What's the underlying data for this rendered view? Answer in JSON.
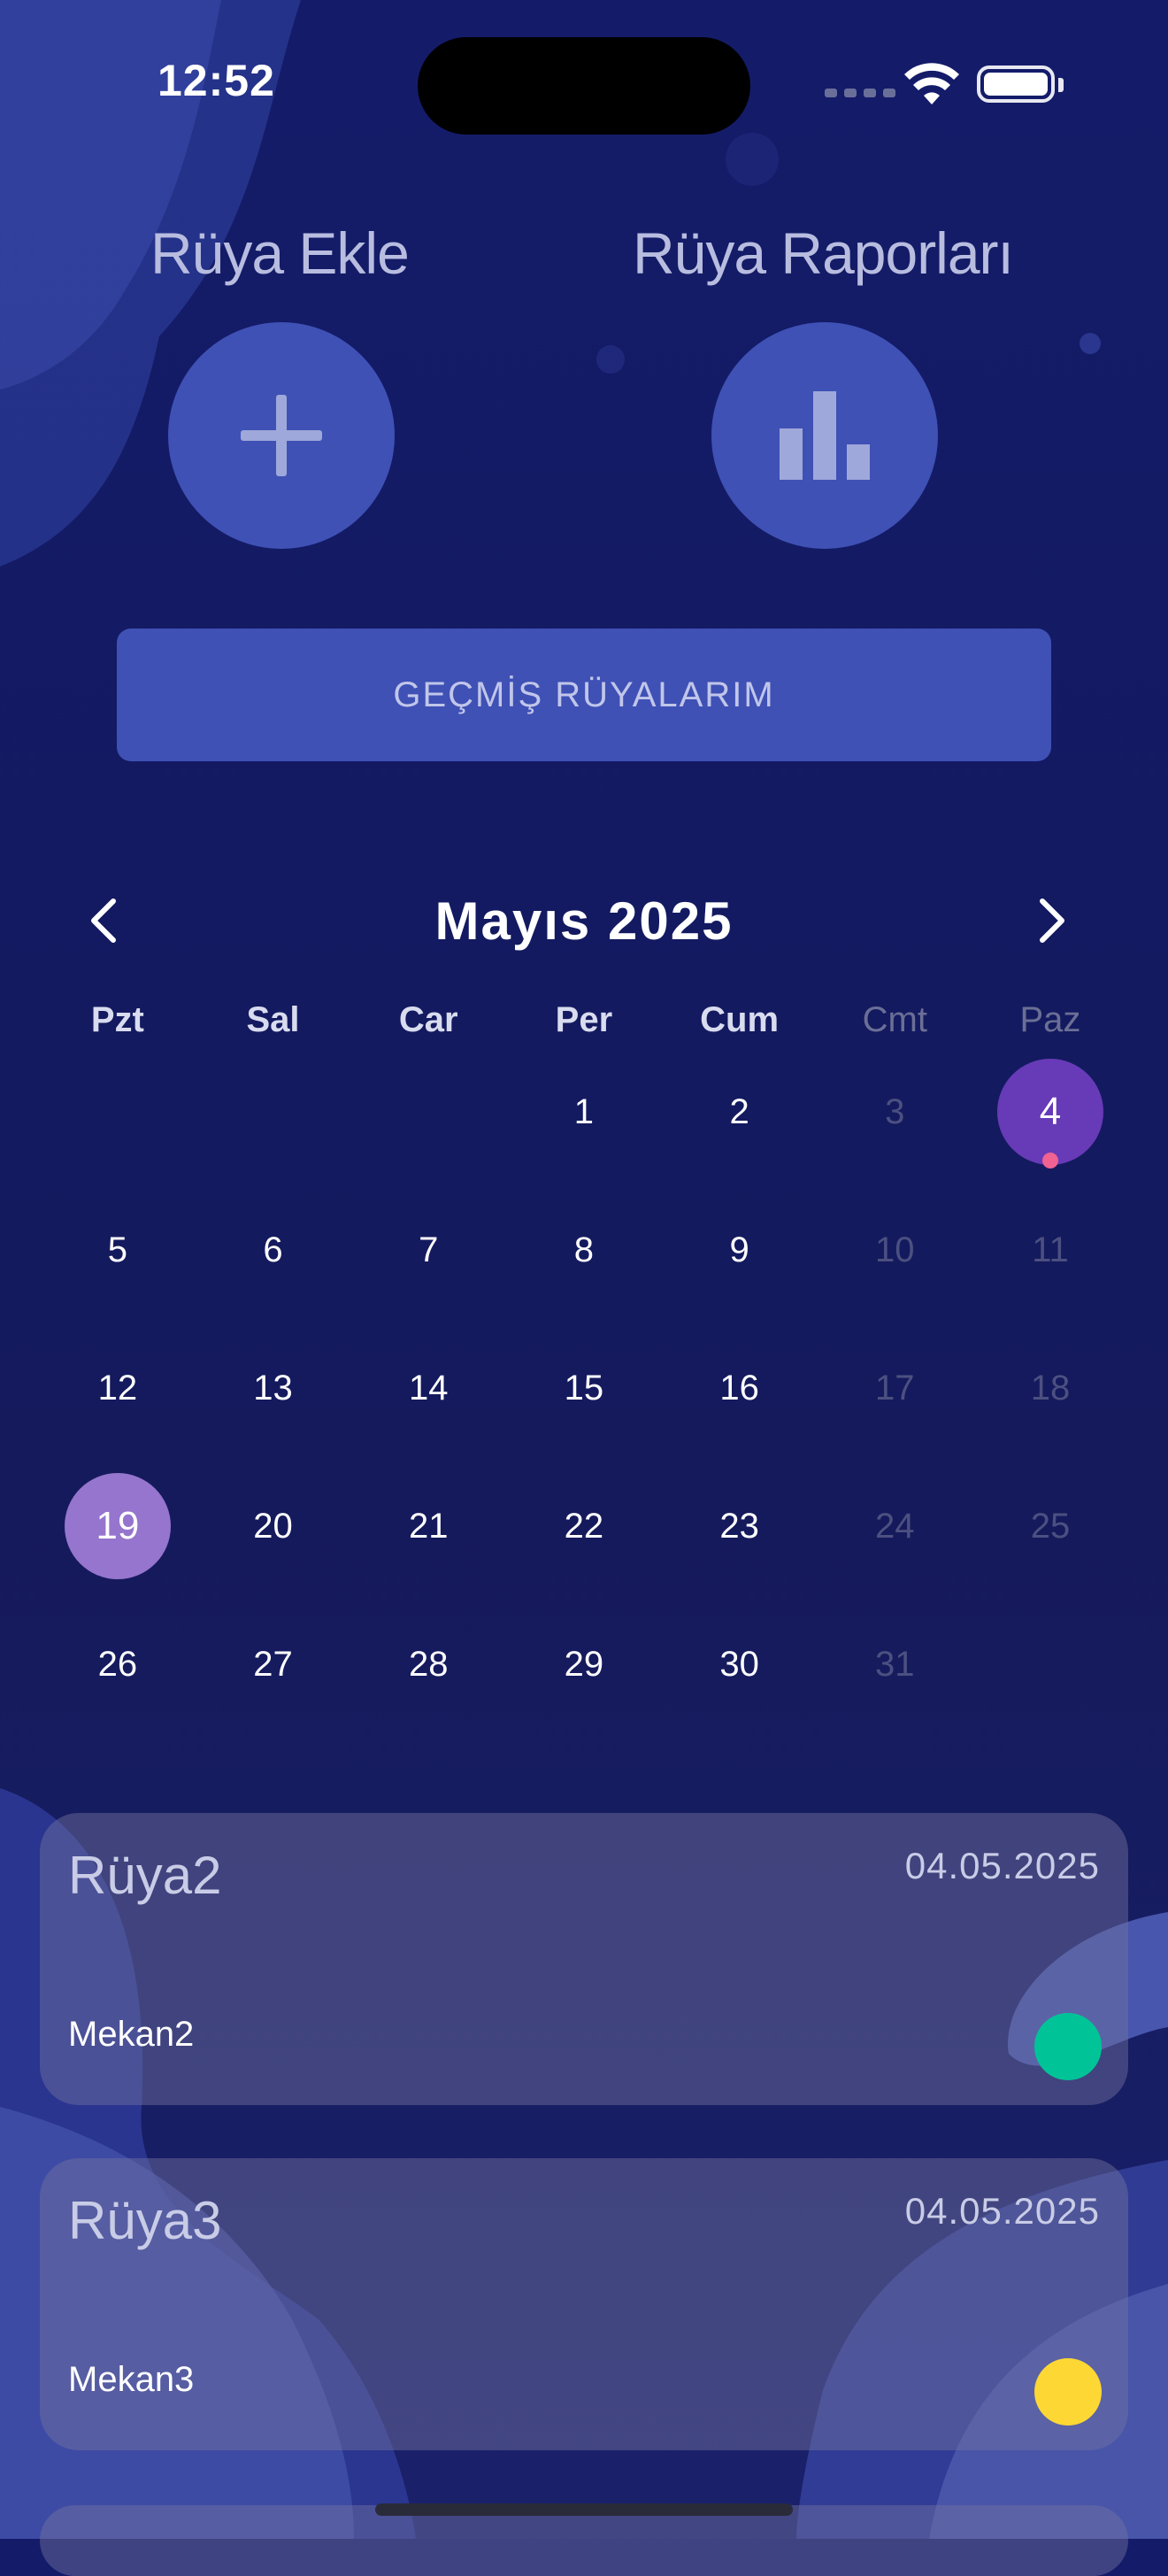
{
  "status_bar": {
    "time": "12:52"
  },
  "actions": {
    "add_label": "Rüya Ekle",
    "reports_label": "Rüya Raporları",
    "add_icon": "plus-icon",
    "reports_icon": "bar-chart-icon"
  },
  "history_button": "GEÇMİŞ RÜYALARIM",
  "calendar": {
    "month_title": "Mayıs 2025",
    "weekdays": [
      "Pzt",
      "Sal",
      "Car",
      "Per",
      "Cum",
      "Cmt",
      "Paz"
    ],
    "leading_blanks": 3,
    "days_in_month": 31,
    "selected_day": 4,
    "today_day": 19,
    "marked_days": [
      4
    ]
  },
  "dreams": [
    {
      "title": "Rüya2",
      "date": "04.05.2025",
      "place": "Mekan2",
      "mood_color": "#00c497"
    },
    {
      "title": "Rüya3",
      "date": "04.05.2025",
      "place": "Mekan3",
      "mood_color": "#fdd835"
    }
  ],
  "colors": {
    "accent": "#3f51b5",
    "selected": "#673ab7",
    "today": "#9575cd",
    "marker": "#f06292"
  }
}
